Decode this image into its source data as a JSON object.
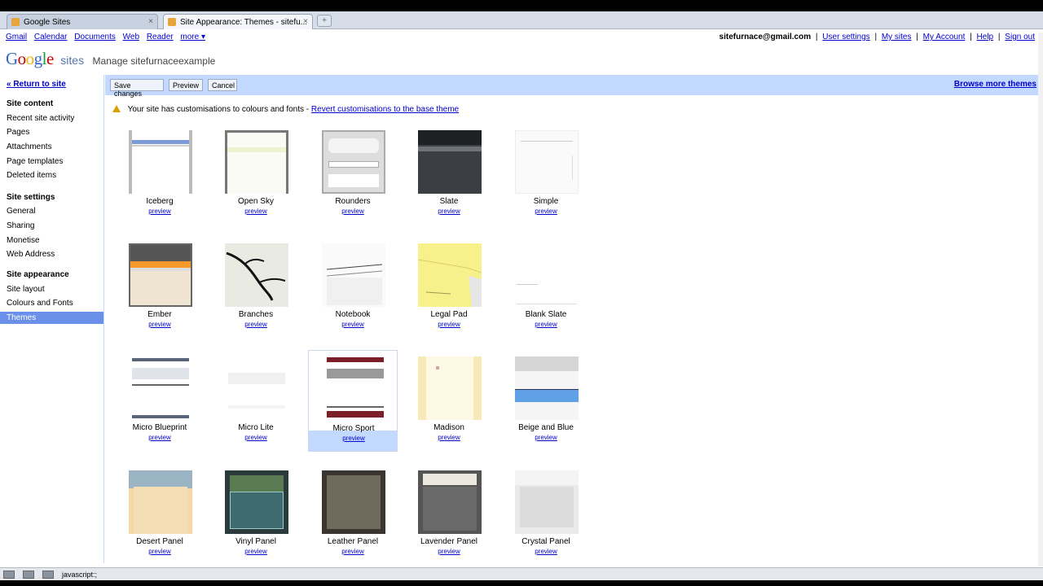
{
  "browser": {
    "tabs": [
      {
        "label": "Google Sites"
      },
      {
        "label": "Site Appearance: Themes - sitefu..."
      }
    ],
    "new_tab": "+",
    "close": "×",
    "status_text": "javascript:;"
  },
  "gbar": {
    "links": [
      "Gmail",
      "Calendar",
      "Documents",
      "Web",
      "Reader",
      "more ▾"
    ],
    "email": "sitefurnace@gmail.com",
    "sep": "|",
    "user_settings": "User settings",
    "my_sites": "My sites",
    "my_account": "My Account",
    "help": "Help",
    "sign_out": "Sign out"
  },
  "header": {
    "logo_sites": "sites",
    "title": "Manage sitefurnaceexample"
  },
  "nav": {
    "return": "« Return to site",
    "site_content": "Site content",
    "content_items": [
      "Recent site activity",
      "Pages",
      "Attachments",
      "Page templates",
      "Deleted items"
    ],
    "site_settings": "Site settings",
    "settings_items": [
      "General",
      "Sharing",
      "Monetise",
      "Web Address"
    ],
    "site_appearance": "Site appearance",
    "appearance_items": [
      "Site layout",
      "Colours and Fonts"
    ],
    "selected": "Themes"
  },
  "toolbar": {
    "save": "Save changes",
    "preview": "Preview",
    "cancel": "Cancel",
    "browse_more": "Browse more themes"
  },
  "warning": {
    "text": "Your site has customisations to colours and fonts -",
    "link": "Revert customisations to the base theme"
  },
  "themes": [
    {
      "name": "Iceberg",
      "preview": "preview"
    },
    {
      "name": "Open Sky",
      "preview": "preview"
    },
    {
      "name": "Rounders",
      "preview": "preview"
    },
    {
      "name": "Slate",
      "preview": "preview"
    },
    {
      "name": "Simple",
      "preview": "preview"
    },
    {
      "name": "Ember",
      "preview": "preview"
    },
    {
      "name": "Branches",
      "preview": "preview"
    },
    {
      "name": "Notebook",
      "preview": "preview"
    },
    {
      "name": "Legal Pad",
      "preview": "preview"
    },
    {
      "name": "Blank Slate",
      "preview": "preview"
    },
    {
      "name": "Micro Blueprint",
      "preview": "preview"
    },
    {
      "name": "Micro Lite",
      "preview": "preview"
    },
    {
      "name": "Micro Sport",
      "preview": "preview"
    },
    {
      "name": "Madison",
      "preview": "preview"
    },
    {
      "name": "Beige and Blue",
      "preview": "preview"
    },
    {
      "name": "Desert Panel",
      "preview": "preview"
    },
    {
      "name": "Vinyl Panel",
      "preview": "preview"
    },
    {
      "name": "Leather Panel",
      "preview": "preview"
    },
    {
      "name": "Lavender Panel",
      "preview": "preview"
    },
    {
      "name": "Crystal Panel",
      "preview": "preview"
    }
  ],
  "selected_theme": "Micro Sport",
  "colors": {
    "accent_bar": "#c3d9ff",
    "nav_selected": "#6b90ea",
    "link": "#0000cc"
  }
}
